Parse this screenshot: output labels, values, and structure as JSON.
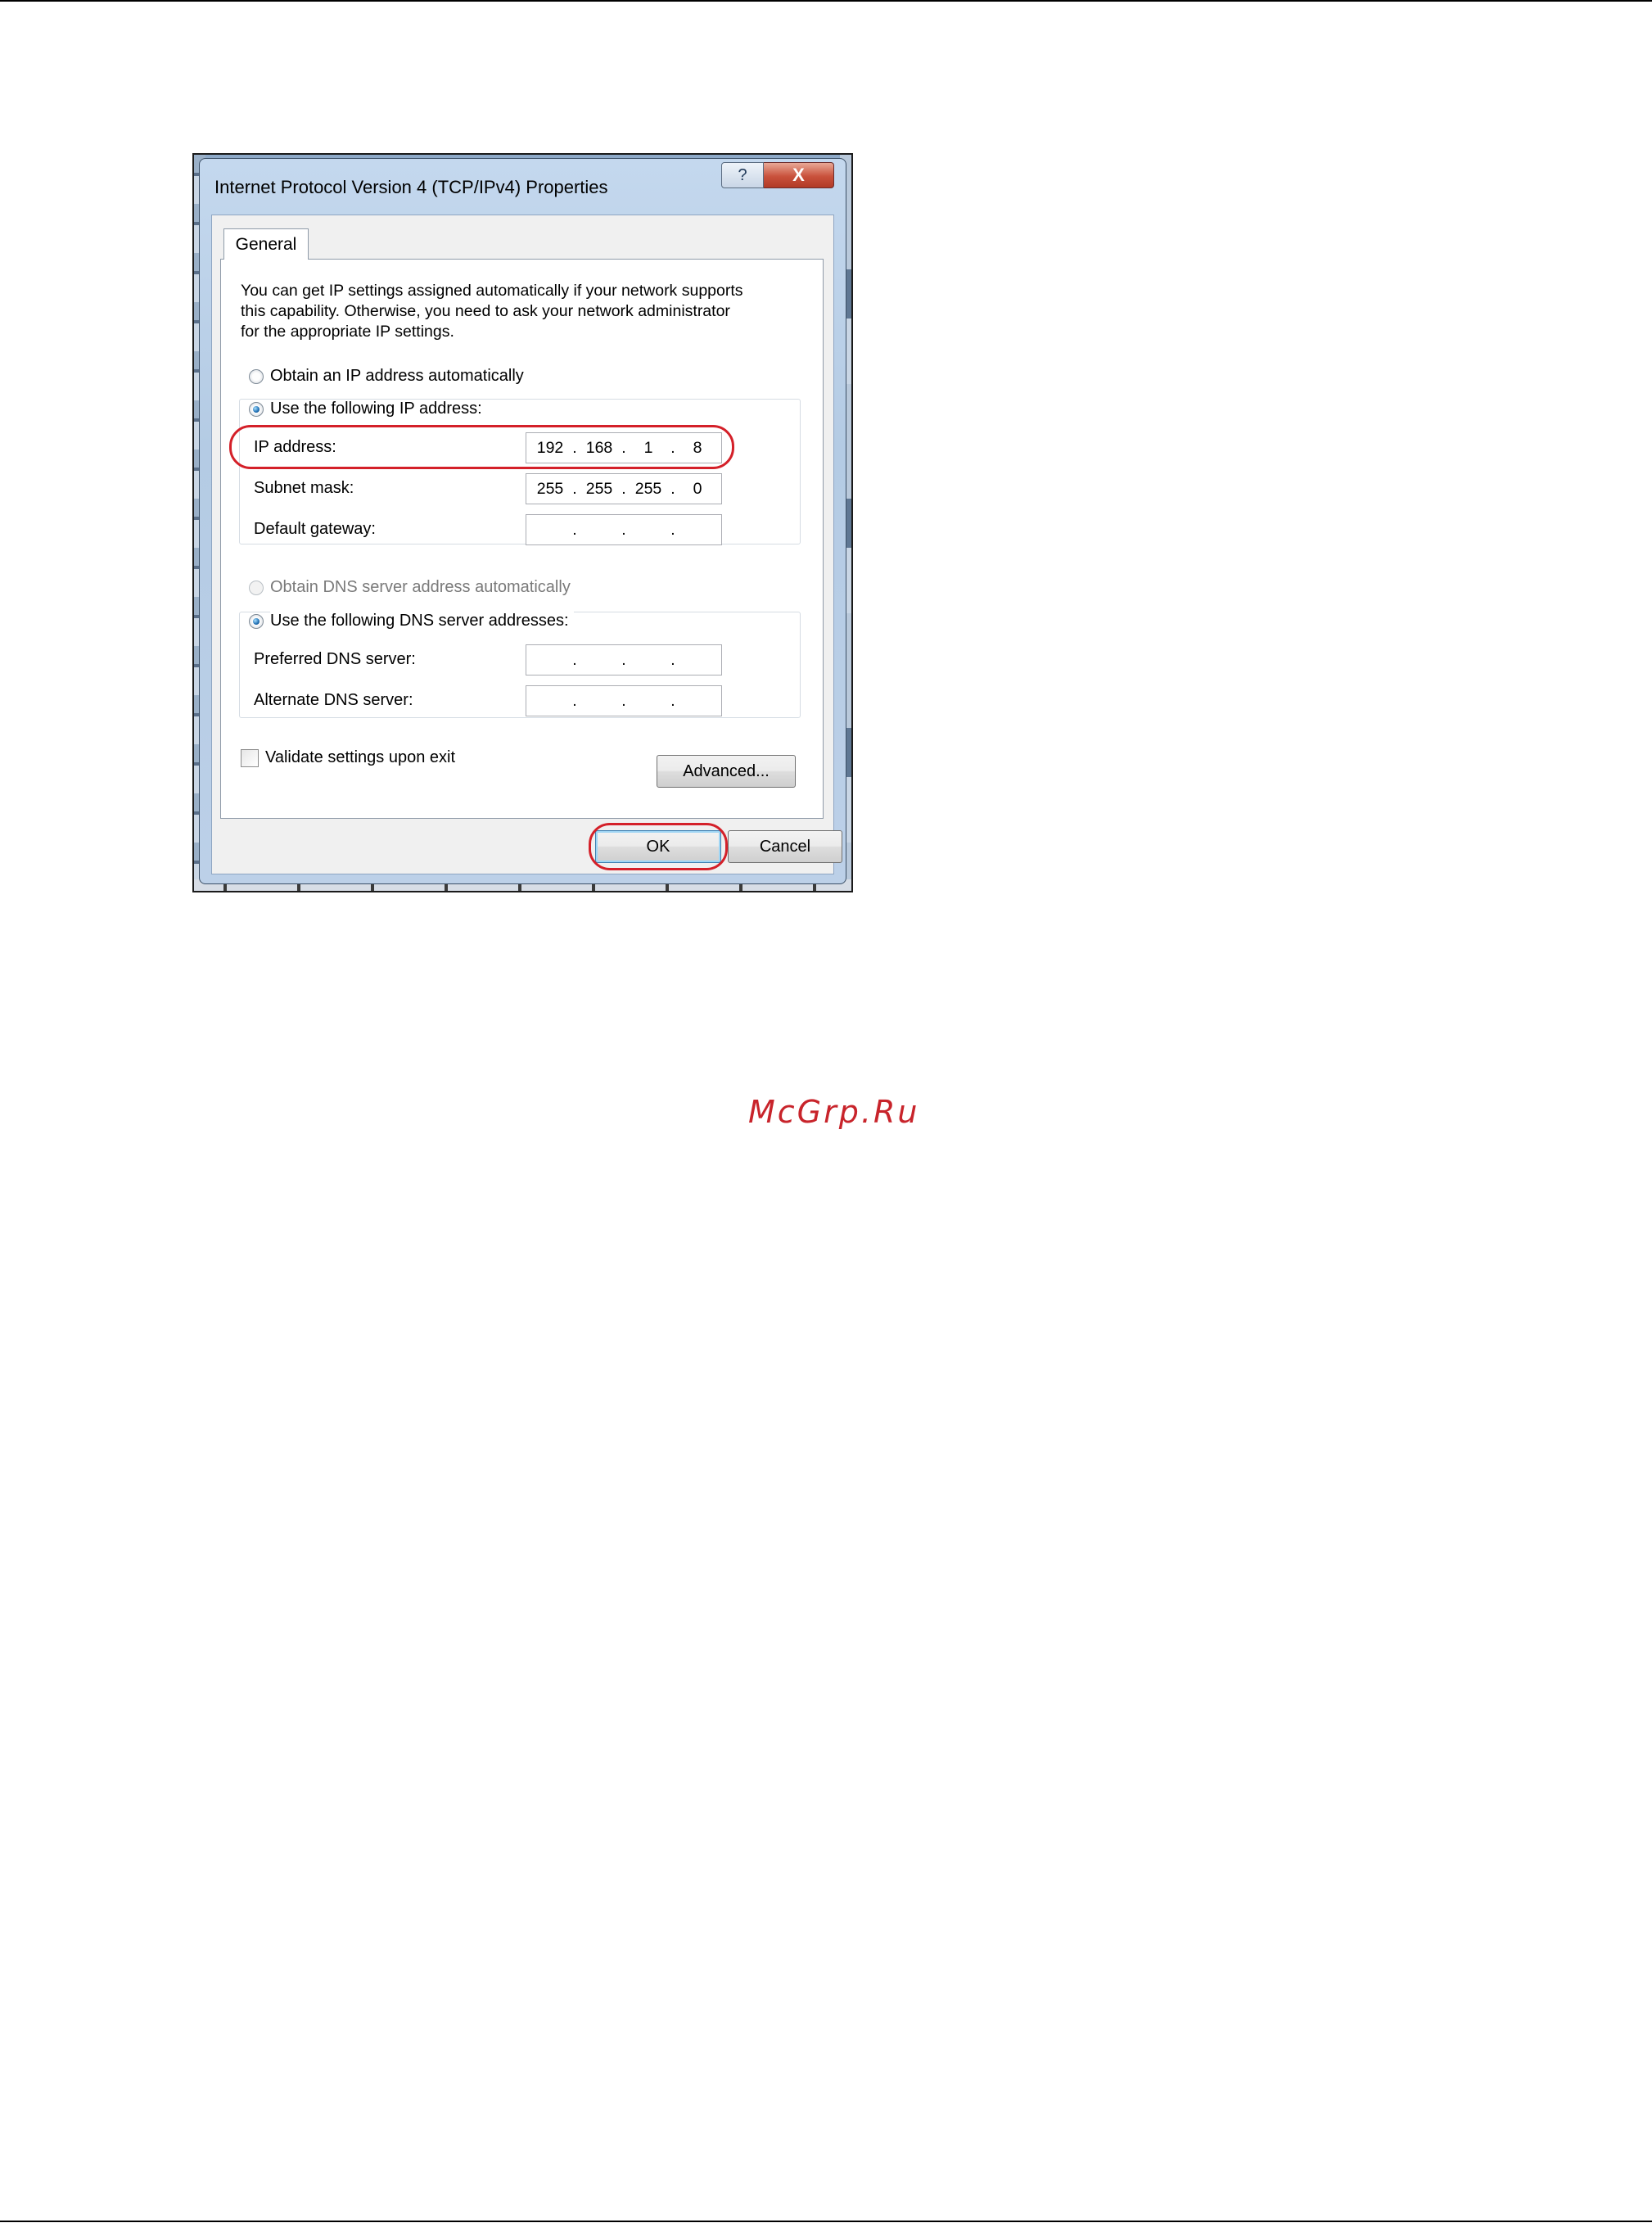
{
  "dialog": {
    "title": "Internet Protocol Version 4 (TCP/IPv4) Properties",
    "help_glyph": "?",
    "close_glyph": "X",
    "tab_general": "General",
    "description": "You can get IP settings assigned automatically if your network supports\nthis capability. Otherwise, you need to ask your network administrator\nfor the appropriate IP settings.",
    "ip_auto_label": "Obtain an IP address automatically",
    "ip_manual_label": "Use the following IP address:",
    "ip_address_label": "IP address:",
    "ip_address": [
      "192",
      "168",
      "1",
      "8"
    ],
    "subnet_mask_label": "Subnet mask:",
    "subnet_mask": [
      "255",
      "255",
      "255",
      "0"
    ],
    "default_gateway_label": "Default gateway:",
    "dns_auto_label": "Obtain DNS server address automatically",
    "dns_manual_label": "Use the following DNS server addresses:",
    "preferred_dns_label": "Preferred DNS server:",
    "alternate_dns_label": "Alternate DNS server:",
    "validate_label": "Validate settings upon exit",
    "advanced_button": "Advanced...",
    "ok_button": "OK",
    "cancel_button": "Cancel",
    "ip_mode": "manual",
    "dns_mode": "manual",
    "validate_checked": false,
    "highlight_color": "#d42029"
  },
  "watermark": "McGrp.Ru",
  "icons": {
    "help": "help-icon",
    "close": "close-icon"
  }
}
